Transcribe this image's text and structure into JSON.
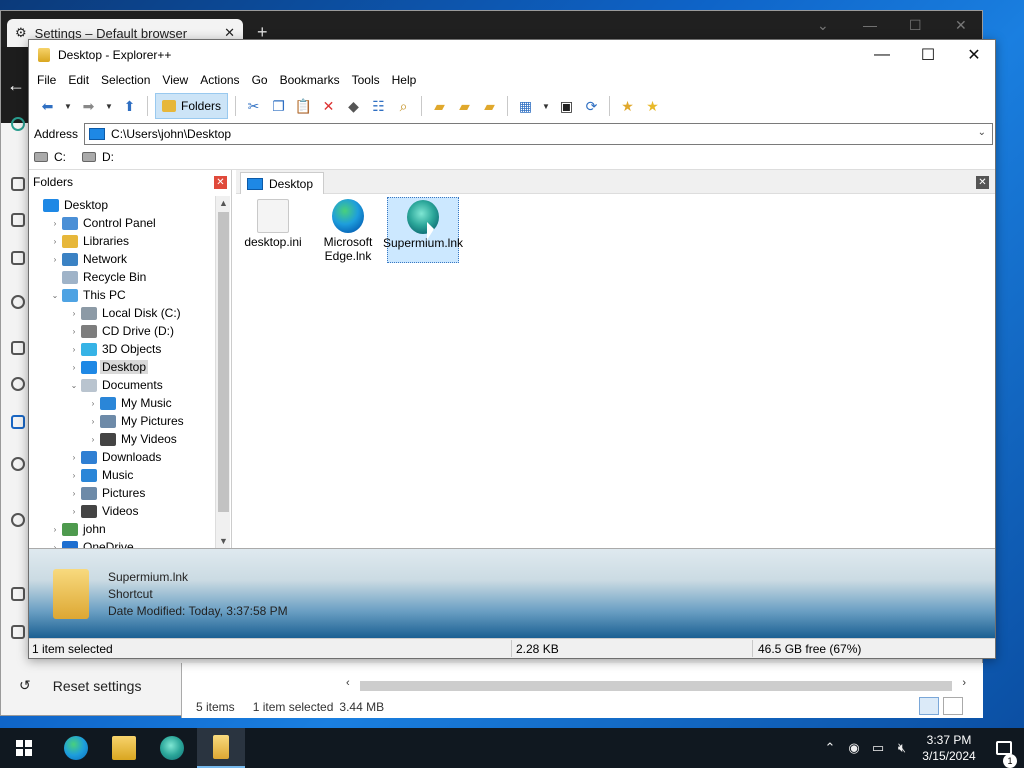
{
  "settings_window": {
    "tab_title": "Settings – Default browser",
    "new_tab": "+",
    "reset_label": "Reset settings"
  },
  "bg_files": {
    "status_items": "5 items",
    "status_selected": "1 item selected",
    "status_size": "3.44 MB"
  },
  "explorer": {
    "title": "Desktop - Explorer++",
    "menu": [
      "File",
      "Edit",
      "Selection",
      "View",
      "Actions",
      "Go",
      "Bookmarks",
      "Tools",
      "Help"
    ],
    "folders_button": "Folders",
    "address_label": "Address",
    "address_value": "C:\\Users\\john\\Desktop",
    "drives": [
      "C:",
      "D:"
    ],
    "folders_pane_title": "Folders",
    "tree": [
      {
        "label": "Desktop",
        "icon": "desktop-icon",
        "color": "#1e88e5"
      },
      {
        "label": "Control Panel",
        "icon": "control-panel-icon",
        "color": "#4a8fd6"
      },
      {
        "label": "Libraries",
        "icon": "libraries-icon",
        "color": "#e7b73a"
      },
      {
        "label": "Network",
        "icon": "network-icon",
        "color": "#3b82c4"
      },
      {
        "label": "Recycle Bin",
        "icon": "recycle-bin-icon",
        "color": "#9fb3c8"
      },
      {
        "label": "This PC",
        "icon": "this-pc-icon",
        "color": "#4fa3e3"
      },
      {
        "label": "Local Disk (C:)",
        "icon": "local-disk-icon",
        "color": "#8c9aa6"
      },
      {
        "label": "CD Drive (D:)",
        "icon": "cd-drive-icon",
        "color": "#7d7d7d"
      },
      {
        "label": "3D Objects",
        "icon": "3d-objects-icon",
        "color": "#36b3e6"
      },
      {
        "label": "Desktop",
        "icon": "desktop-icon",
        "color": "#1e88e5"
      },
      {
        "label": "Documents",
        "icon": "documents-icon",
        "color": "#b9c4cf"
      },
      {
        "label": "My Music",
        "icon": "music-icon",
        "color": "#2a86d8"
      },
      {
        "label": "My Pictures",
        "icon": "pictures-icon",
        "color": "#6d8aa8"
      },
      {
        "label": "My Videos",
        "icon": "videos-icon",
        "color": "#444444"
      },
      {
        "label": "Downloads",
        "icon": "downloads-icon",
        "color": "#2f7fd3"
      },
      {
        "label": "Music",
        "icon": "music-icon",
        "color": "#2a86d8"
      },
      {
        "label": "Pictures",
        "icon": "pictures-icon",
        "color": "#6d8aa8"
      },
      {
        "label": "Videos",
        "icon": "videos-icon",
        "color": "#444444"
      },
      {
        "label": "john",
        "icon": "user-icon",
        "color": "#4e9a4e"
      },
      {
        "label": "OneDrive",
        "icon": "onedrive-icon",
        "color": "#1e6fd0"
      }
    ],
    "tab_label": "Desktop",
    "files": [
      {
        "name": "desktop.ini",
        "icon": "settings-file-icon"
      },
      {
        "name": "Microsoft Edge.lnk",
        "icon": "edge-icon"
      },
      {
        "name": "Supermium.lnk",
        "icon": "supermium-icon"
      }
    ],
    "info": {
      "name": "Supermium.lnk",
      "type": "Shortcut",
      "modified": "Date Modified: Today, 3:37:58 PM"
    },
    "status": {
      "selected": "1 item selected",
      "size": "2.28 KB",
      "free": "46.5 GB free (67%)"
    }
  },
  "taskbar": {
    "time": "3:37 PM",
    "date": "3/15/2024",
    "notification_count": "1",
    "apps": [
      "edge-icon",
      "file-explorer-icon",
      "supermium-icon",
      "explorerpp-icon"
    ]
  }
}
